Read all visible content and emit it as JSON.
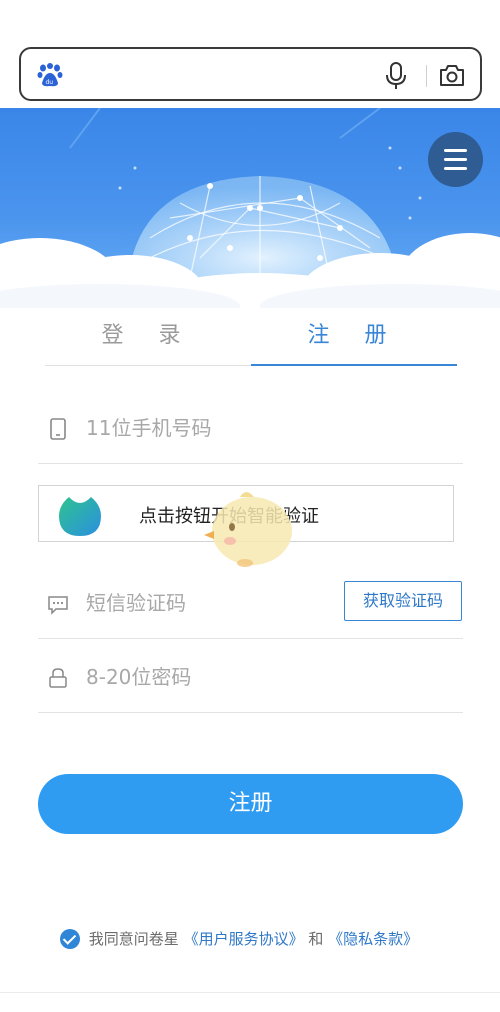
{
  "browser": {
    "icons": {
      "logo": "baidu-paw-icon",
      "voice": "microphone-icon",
      "camera": "camera-icon"
    }
  },
  "header": {
    "menu_icon": "hamburger-menu-icon"
  },
  "tabs": [
    {
      "label": "登 录",
      "active": false
    },
    {
      "label": "注 册",
      "active": true
    }
  ],
  "form": {
    "phone_placeholder": "11位手机号码",
    "captcha_text": "点击按钮开始智能验证",
    "sms_placeholder": "短信验证码",
    "sms_button": "获取验证码",
    "password_placeholder": "8-20位密码",
    "submit_label": "注册"
  },
  "agreement": {
    "checked": true,
    "prefix": "我同意问卷星",
    "service_link": "《用户服务协议》",
    "conjunction": "和",
    "privacy_link": "《隐私条款》"
  },
  "colors": {
    "accent": "#3a86d6",
    "submit": "#2f9cf2",
    "hero_top": "#3a86e8",
    "menu_bg": "#2f5c93"
  }
}
